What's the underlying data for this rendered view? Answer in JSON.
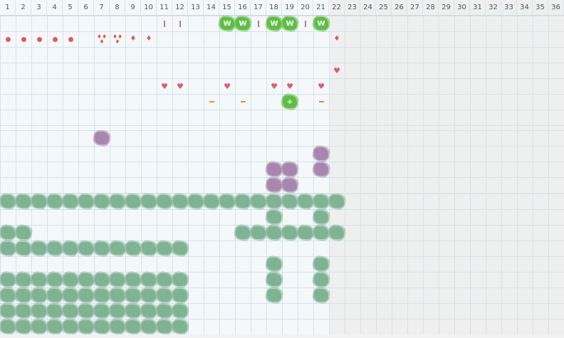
{
  "calendar": {
    "days": [
      "1",
      "2",
      "3",
      "4",
      "5",
      "6",
      "7",
      "8",
      "9",
      "10",
      "11",
      "12",
      "13",
      "14",
      "15",
      "16",
      "17",
      "18",
      "19",
      "20",
      "21",
      "22",
      "23",
      "24",
      "25",
      "26",
      "27",
      "28",
      "29",
      "30",
      "31",
      "32",
      "33",
      "34",
      "35",
      "36"
    ],
    "active_days": 21,
    "colors": {
      "active_bg": "#f4f8fa",
      "inactive_bg": "#efefef",
      "period_red": "#e05a5a",
      "heart_pink": "#e05a6e",
      "blob_green": "#7fb394",
      "blob_purple": "#a886ae",
      "blob_bright_green": "#5fbd45",
      "orange_mark": "#f08a30"
    }
  },
  "sections": [
    {
      "name": "top",
      "rows": 7,
      "marks": [
        {
          "col": 11,
          "row": 0,
          "icon": "bar"
        },
        {
          "col": 12,
          "row": 0,
          "icon": "bar"
        },
        {
          "col": 15,
          "row": 0,
          "icon": "w-blob",
          "label": "W"
        },
        {
          "col": 16,
          "row": 0,
          "icon": "w-blob",
          "label": "W"
        },
        {
          "col": 17,
          "row": 0,
          "icon": "bar"
        },
        {
          "col": 18,
          "row": 0,
          "icon": "w-blob",
          "label": "W"
        },
        {
          "col": 19,
          "row": 0,
          "icon": "w-blob",
          "label": "W"
        },
        {
          "col": 20,
          "row": 0,
          "icon": "bar"
        },
        {
          "col": 21,
          "row": 0,
          "icon": "w-blob",
          "label": "W"
        },
        {
          "col": 1,
          "row": 1,
          "icon": "dot"
        },
        {
          "col": 2,
          "row": 1,
          "icon": "dot"
        },
        {
          "col": 3,
          "row": 1,
          "icon": "dot"
        },
        {
          "col": 4,
          "row": 1,
          "icon": "dot"
        },
        {
          "col": 5,
          "row": 1,
          "icon": "dot"
        },
        {
          "col": 7,
          "row": 1,
          "icon": "drops"
        },
        {
          "col": 8,
          "row": 1,
          "icon": "drops"
        },
        {
          "col": 9,
          "row": 1,
          "icon": "drop"
        },
        {
          "col": 10,
          "row": 1,
          "icon": "drop"
        },
        {
          "col": 22,
          "row": 1,
          "icon": "drop"
        },
        {
          "col": 22,
          "row": 3,
          "icon": "heart"
        },
        {
          "col": 11,
          "row": 4,
          "icon": "heart"
        },
        {
          "col": 12,
          "row": 4,
          "icon": "heart"
        },
        {
          "col": 15,
          "row": 4,
          "icon": "heart"
        },
        {
          "col": 18,
          "row": 4,
          "icon": "heart"
        },
        {
          "col": 19,
          "row": 4,
          "icon": "heart"
        },
        {
          "col": 21,
          "row": 4,
          "icon": "heart"
        },
        {
          "col": 14,
          "row": 5,
          "icon": "dash"
        },
        {
          "col": 16,
          "row": 5,
          "icon": "dash"
        },
        {
          "col": 19,
          "row": 5,
          "icon": "plus-blob",
          "label": "+"
        },
        {
          "col": 21,
          "row": 5,
          "icon": "dash"
        },
        {
          "col": 7,
          "row": 7,
          "icon": "bar-orange"
        }
      ]
    },
    {
      "name": "middle",
      "rows": 4,
      "marks": [
        {
          "col": 7,
          "row": 0,
          "icon": "purple-blob"
        },
        {
          "col": 21,
          "row": 1,
          "icon": "purple-blob"
        },
        {
          "col": 18,
          "row": 2,
          "icon": "purple-blob"
        },
        {
          "col": 19,
          "row": 2,
          "icon": "purple-blob"
        },
        {
          "col": 21,
          "row": 2,
          "icon": "purple-blob"
        },
        {
          "col": 18,
          "row": 3,
          "icon": "purple-blob"
        },
        {
          "col": 19,
          "row": 3,
          "icon": "purple-blob"
        }
      ]
    },
    {
      "name": "bottom",
      "rows": 9,
      "green_rows": [
        {
          "row": 0,
          "cols": [
            1,
            2,
            3,
            4,
            5,
            6,
            7,
            8,
            9,
            10,
            11,
            12,
            13,
            14,
            15,
            16,
            17,
            18,
            19,
            20,
            21,
            22
          ]
        },
        {
          "row": 1,
          "cols": [
            18,
            21
          ]
        },
        {
          "row": 2,
          "cols": [
            1,
            2,
            16,
            17,
            18,
            19,
            20,
            21,
            22
          ]
        },
        {
          "row": 3,
          "cols": [
            1,
            2,
            3,
            4,
            5,
            6,
            7,
            8,
            9,
            10,
            11,
            12
          ]
        },
        {
          "row": 4,
          "cols": [
            18,
            21
          ]
        },
        {
          "row": 5,
          "cols": [
            1,
            2,
            3,
            4,
            5,
            6,
            7,
            8,
            9,
            10,
            11,
            12,
            18,
            21
          ]
        },
        {
          "row": 6,
          "cols": [
            1,
            2,
            3,
            4,
            5,
            6,
            7,
            8,
            9,
            10,
            11,
            12,
            18,
            21
          ]
        },
        {
          "row": 7,
          "cols": [
            1,
            2,
            3,
            4,
            5,
            6,
            7,
            8,
            9,
            10,
            11,
            12
          ]
        },
        {
          "row": 8,
          "cols": [
            1,
            2,
            3,
            4,
            5,
            6,
            7,
            8,
            9,
            10,
            11,
            12
          ]
        }
      ]
    }
  ]
}
